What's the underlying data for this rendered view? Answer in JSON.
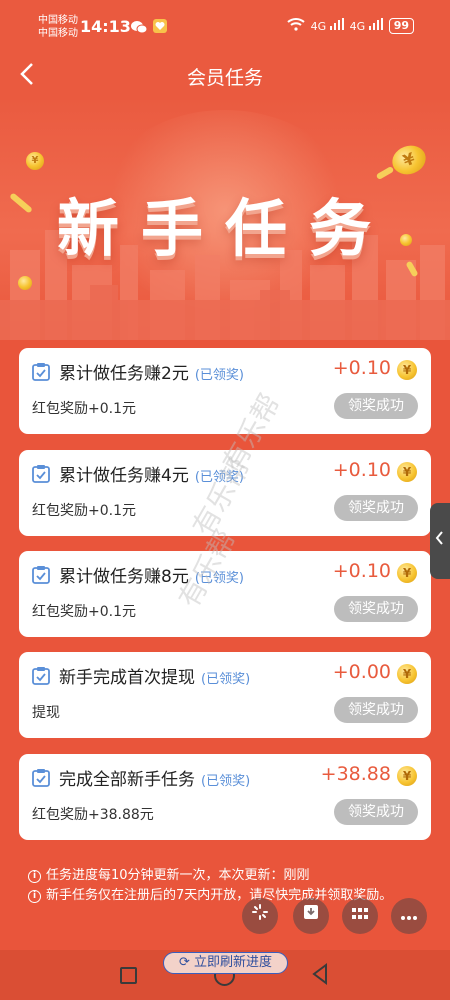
{
  "status_bar": {
    "carrier_1": "中国移动",
    "carrier_2": "中国移动",
    "time": "14:13",
    "net_1": "4G",
    "net_2": "4G",
    "battery": "99"
  },
  "header": {
    "title": "会员任务",
    "back_icon": "back-arrow-icon"
  },
  "banner": {
    "title": "新手任务"
  },
  "tasks": [
    {
      "title": "累计做任务赚2元",
      "tag": "(已领奖)",
      "reward": "+0.10",
      "coin_symbol": "¥",
      "desc": "红包奖励+0.1元",
      "status": "领奖成功"
    },
    {
      "title": "累计做任务赚4元",
      "tag": "(已领奖)",
      "reward": "+0.10",
      "coin_symbol": "¥",
      "desc": "红包奖励+0.1元",
      "status": "领奖成功"
    },
    {
      "title": "累计做任务赚8元",
      "tag": "(已领奖)",
      "reward": "+0.10",
      "coin_symbol": "¥",
      "desc": "红包奖励+0.1元",
      "status": "领奖成功"
    },
    {
      "title": "新手完成首次提现",
      "tag": "(已领奖)",
      "reward": "+0.00",
      "coin_symbol": "¥",
      "desc": "提现",
      "status": "领奖成功"
    },
    {
      "title": "完成全部新手任务",
      "tag": "(已领奖)",
      "reward": "+38.88",
      "coin_symbol": "¥",
      "desc": "红包奖励+38.88元",
      "status": "领奖成功"
    }
  ],
  "notes": [
    "任务进度每10分钟更新一次，本次更新：刚刚",
    "新手任务仅在注册后的7天内开放，请尽快完成并领取奖励。"
  ],
  "refresh_button": "立即刷新进度",
  "watermark": "有乐帮",
  "floating_buttons": [
    "loading-icon",
    "download-icon",
    "grid-icon",
    "more-icon"
  ],
  "colors": {
    "background": "#e9553b",
    "reward": "#e85b3e",
    "tag": "#5a8fd8",
    "status_button": "#bdbdbd"
  }
}
